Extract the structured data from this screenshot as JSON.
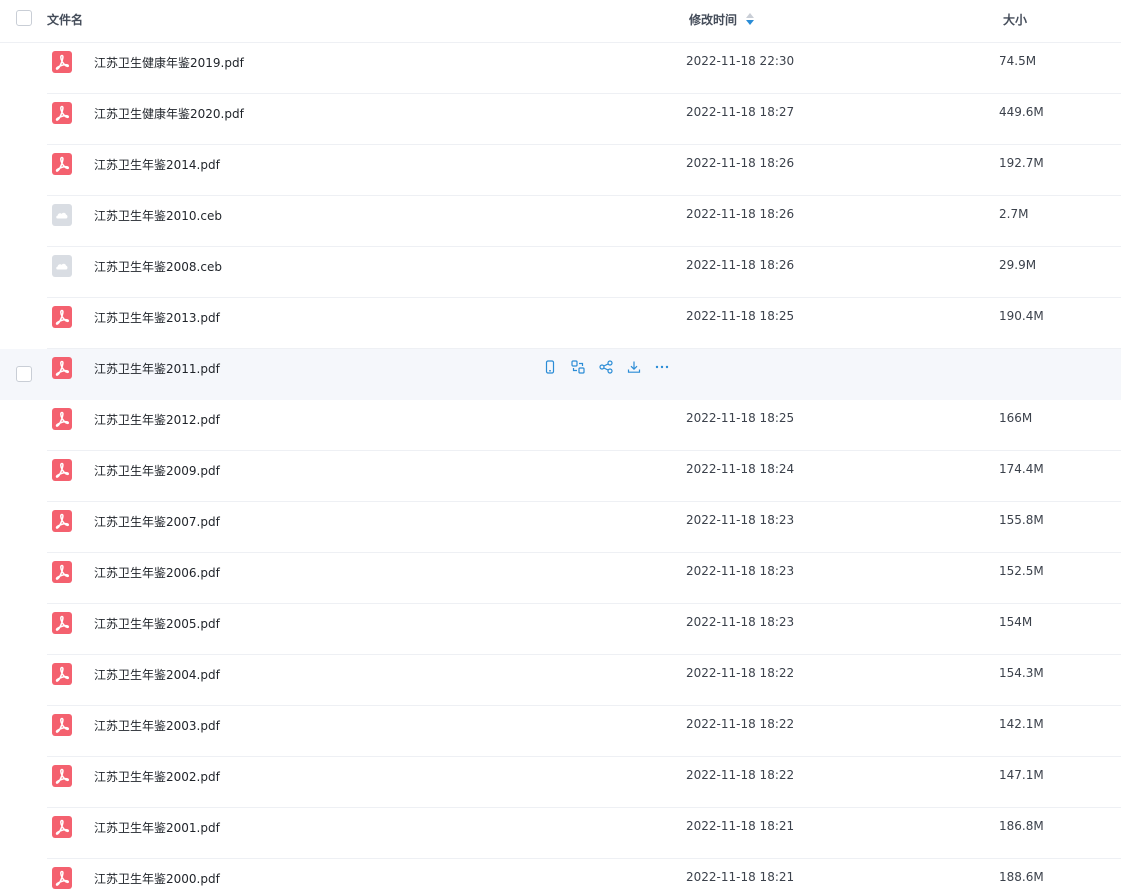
{
  "header": {
    "name_label": "文件名",
    "time_label": "修改时间",
    "size_label": "大小"
  },
  "rows": [
    {
      "name": "江苏卫生健康年鉴2019.pdf",
      "type": "pdf",
      "time": "2022-11-18 22:30",
      "size": "74.5M"
    },
    {
      "name": "江苏卫生健康年鉴2020.pdf",
      "type": "pdf",
      "time": "2022-11-18 18:27",
      "size": "449.6M"
    },
    {
      "name": "江苏卫生年鉴2014.pdf",
      "type": "pdf",
      "time": "2022-11-18 18:26",
      "size": "192.7M"
    },
    {
      "name": "江苏卫生年鉴2010.ceb",
      "type": "ceb",
      "time": "2022-11-18 18:26",
      "size": "2.7M"
    },
    {
      "name": "江苏卫生年鉴2008.ceb",
      "type": "ceb",
      "time": "2022-11-18 18:26",
      "size": "29.9M"
    },
    {
      "name": "江苏卫生年鉴2013.pdf",
      "type": "pdf",
      "time": "2022-11-18 18:25",
      "size": "190.4M"
    },
    {
      "name": "江苏卫生年鉴2011.pdf",
      "type": "pdf",
      "time": "",
      "size": "",
      "hovered": true
    },
    {
      "name": "江苏卫生年鉴2012.pdf",
      "type": "pdf",
      "time": "2022-11-18 18:25",
      "size": "166M"
    },
    {
      "name": "江苏卫生年鉴2009.pdf",
      "type": "pdf",
      "time": "2022-11-18 18:24",
      "size": "174.4M"
    },
    {
      "name": "江苏卫生年鉴2007.pdf",
      "type": "pdf",
      "time": "2022-11-18 18:23",
      "size": "155.8M"
    },
    {
      "name": "江苏卫生年鉴2006.pdf",
      "type": "pdf",
      "time": "2022-11-18 18:23",
      "size": "152.5M"
    },
    {
      "name": "江苏卫生年鉴2005.pdf",
      "type": "pdf",
      "time": "2022-11-18 18:23",
      "size": "154M"
    },
    {
      "name": "江苏卫生年鉴2004.pdf",
      "type": "pdf",
      "time": "2022-11-18 18:22",
      "size": "154.3M"
    },
    {
      "name": "江苏卫生年鉴2003.pdf",
      "type": "pdf",
      "time": "2022-11-18 18:22",
      "size": "142.1M"
    },
    {
      "name": "江苏卫生年鉴2002.pdf",
      "type": "pdf",
      "time": "2022-11-18 18:22",
      "size": "147.1M"
    },
    {
      "name": "江苏卫生年鉴2001.pdf",
      "type": "pdf",
      "time": "2022-11-18 18:21",
      "size": "186.8M"
    },
    {
      "name": "江苏卫生年鉴2000.pdf",
      "type": "pdf",
      "time": "2022-11-18 18:21",
      "size": "188.6M"
    }
  ],
  "row_actions": [
    "phone-icon",
    "convert-icon",
    "share-icon",
    "download-icon",
    "more-icon"
  ],
  "colors": {
    "pdf_icon": "#f4616f",
    "ceb_icon": "#d9dde3",
    "accent": "#2a8cd6",
    "hover_row": "#f5f7fb",
    "divider": "#eef0f4"
  }
}
